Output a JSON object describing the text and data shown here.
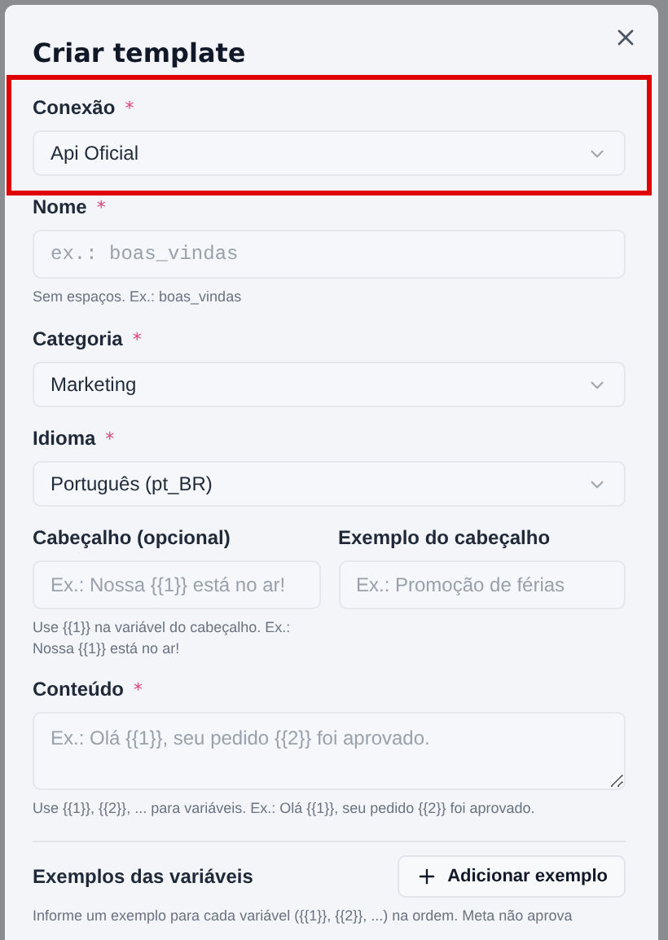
{
  "dialog": {
    "title": "Criar template"
  },
  "fields": [
    {
      "kind": "select",
      "label": "Conexão",
      "required_mark": "*",
      "value": "Api Oficial",
      "highlighted": true
    },
    {
      "kind": "input",
      "label": "Nome",
      "required_mark": "*",
      "placeholder": "ex.: boas_vindas",
      "monospace": true,
      "hint": "Sem espaços. Ex.: boas_vindas"
    },
    {
      "kind": "select",
      "label": "Categoria",
      "required_mark": "*",
      "value": "Marketing"
    },
    {
      "kind": "select",
      "label": "Idioma",
      "required_mark": "*",
      "value": "Português (pt_BR)"
    },
    {
      "kind": "pair",
      "columns": [
        {
          "label": "Cabeçalho (opcional)",
          "placeholder": "Ex.: Nossa {{1}} está no ar!",
          "hint": "Use {{1}} na variável do cabeçalho. Ex.: Nossa {{1}} está no ar!"
        },
        {
          "label": "Exemplo do cabeçalho",
          "placeholder": "Ex.: Promoção de férias"
        }
      ]
    },
    {
      "kind": "textarea",
      "label": "Conteúdo",
      "required_mark": "*",
      "placeholder": "Ex.: Olá {{1}}, seu pedido {{2}} foi aprovado.",
      "hint": "Use {{1}}, {{2}}, ... para variáveis. Ex.: Olá {{1}}, seu pedido {{2}} foi aprovado."
    }
  ],
  "examples": {
    "title": "Exemplos das variáveis",
    "button": "Adicionar exemplo",
    "note": "Informe um exemplo para cada variável ({{1}}, {{2}}, ...) na ordem. Meta não aprova"
  }
}
